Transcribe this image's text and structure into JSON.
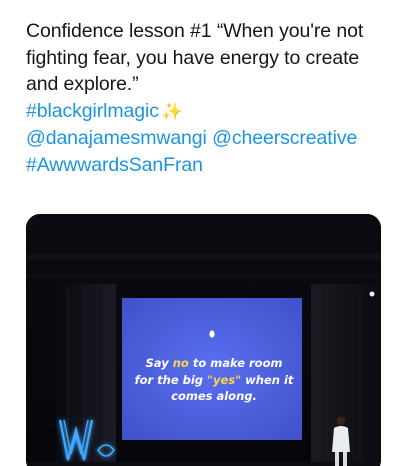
{
  "tweet": {
    "line1": "Confidence lesson #1 “When you're not",
    "line2": "fighting fear, you have energy to create",
    "line3": "and explore.”",
    "hashtag1": "#blackgirlmagic",
    "sparkle_emoji": "✨",
    "mention1": "@danajamesmwangi",
    "mention2": "@cheerscreative",
    "hashtag2": "#AwwwardsSanFran"
  },
  "media": {
    "alt": "Speaker on stage in front of a projected slide",
    "slide": {
      "part1": "Say ",
      "highlight1": "no",
      "part2": " to make room",
      "part3": "for the big ",
      "highlight2": "\"yes\"",
      "part4": " when it",
      "part5": "comes along."
    },
    "logo_text": "W"
  },
  "colors": {
    "link": "#1b95e0",
    "text": "#14171a",
    "slide_bg": "#4a5fd8",
    "slide_highlight": "#ffd54a",
    "logo_glow": "#3fa9ff"
  }
}
